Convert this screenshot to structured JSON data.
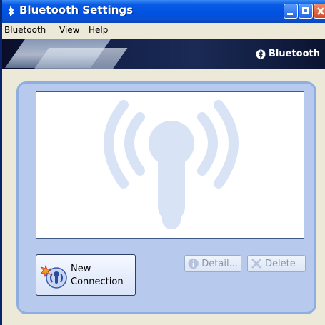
{
  "window": {
    "title": "Bluetooth Settings",
    "title_icon": "bluetooth-icon"
  },
  "menu": {
    "items": [
      "Bluetooth",
      "View",
      "Help"
    ]
  },
  "banner": {
    "brand": "Bluetooth"
  },
  "actions": {
    "new_connection": [
      "New",
      "Connection"
    ],
    "detail": "Detail...",
    "delete": "Delete"
  },
  "colors": {
    "titlebar": "#0052e0",
    "panel": "#b7c9ec",
    "panel_border": "#8eaee2"
  }
}
